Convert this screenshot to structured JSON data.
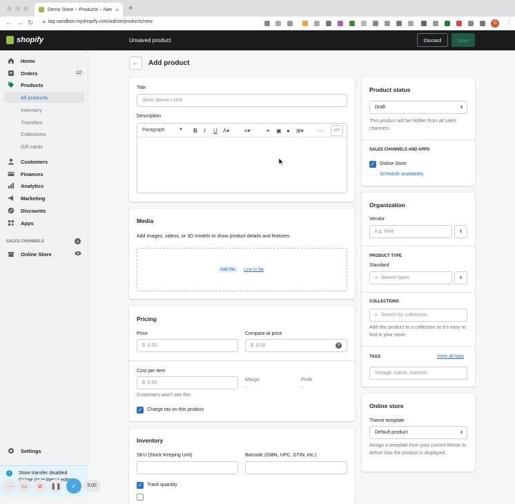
{
  "browser": {
    "tab_title": "Demo Store ~ Products ~ New",
    "new_tab": "+",
    "url": "tag-sandbox.myshopify.com/admin/products/new",
    "profile_initial": "D"
  },
  "topbar": {
    "logo": "shopify",
    "page_state": "Unsaved product",
    "discard": "Discard",
    "save": "Save"
  },
  "sidebar": {
    "items": [
      {
        "label": "Home"
      },
      {
        "label": "Orders",
        "badge": "12"
      },
      {
        "label": "Products"
      },
      {
        "label": "All products"
      },
      {
        "label": "Inventory"
      },
      {
        "label": "Transfers"
      },
      {
        "label": "Collections"
      },
      {
        "label": "Gift cards"
      },
      {
        "label": "Customers"
      },
      {
        "label": "Finances"
      },
      {
        "label": "Analytics"
      },
      {
        "label": "Marketing"
      },
      {
        "label": "Discounts"
      },
      {
        "label": "Apps"
      }
    ],
    "channels_heading": "SALES CHANNELS",
    "online_store": "Online Store",
    "settings": "Settings",
    "toast_title": "Store transfer disabled",
    "toast_body": "Online store theme editor",
    "timer": "5:00"
  },
  "page": {
    "title": "Add product"
  },
  "product": {
    "title_label": "Title",
    "title_placeholder": "Short sleeve t-shirt",
    "description_label": "Description",
    "format_select": "Paragraph"
  },
  "media": {
    "heading": "Media",
    "hint": "Add images, videos, or 3D models to show product details and features.",
    "add_file": "Add file",
    "link_file": "Link to file"
  },
  "pricing": {
    "heading": "Pricing",
    "price_label": "Price",
    "price_value": "0.00",
    "compare_label": "Compare at price",
    "compare_value": "0.00",
    "currency": "$",
    "cost_label": "Cost per item",
    "cost_value": "0.00",
    "margin_label": "Margin",
    "margin_value": "-",
    "profit_label": "Profit",
    "profit_value": "-",
    "cost_hint": "Customers won't see this",
    "charge_tax": "Charge tax on this product"
  },
  "inventory": {
    "heading": "Inventory",
    "sku_label": "SKU (Stock Keeping Unit)",
    "barcode_label": "Barcode (ISBN, UPC, GTIN, etc.)",
    "track_qty": "Track quantity"
  },
  "status": {
    "heading": "Product status",
    "value": "Draft",
    "hint": "This product will be hidden from all sales channels.",
    "channels_heading": "SALES CHANNELS AND APPS",
    "channel": "Online Store",
    "schedule": "Schedule availability"
  },
  "organization": {
    "heading": "Organization",
    "vendor_label": "Vendor",
    "vendor_placeholder": "e.g. Nike",
    "type_heading": "PRODUCT TYPE",
    "type_label": "Standard",
    "type_placeholder": "Search types",
    "collections_heading": "COLLECTIONS",
    "collections_placeholder": "Search for collections",
    "collections_hint": "Add this product to a collection so it's easy to find in your store.",
    "tags_heading": "TAGS",
    "view_tags": "View all tags",
    "tags_placeholder": "Vintage, cotton, summer"
  },
  "online_store": {
    "heading": "Online store",
    "template_label": "Theme template",
    "template_value": "Default product",
    "hint": "Assign a template from your current theme to define how the product is displayed."
  },
  "colors": {
    "accent": "#2c6ecb",
    "brand": "#95bf47",
    "topbar": "#1a1c1d"
  }
}
